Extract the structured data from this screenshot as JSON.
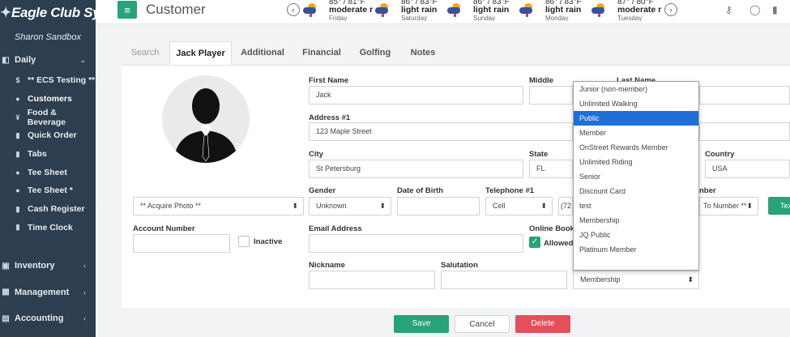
{
  "brand": {
    "name": "Eagle Club Systems",
    "subtitle": "Sharon Sandbox"
  },
  "sidebar": {
    "section_daily": "Daily",
    "items": [
      {
        "icon": "dollar-icon",
        "glyph": "$",
        "label": "** ECS Testing **"
      },
      {
        "icon": "user-icon",
        "glyph": "●",
        "label": "Customers"
      },
      {
        "icon": "cutlery-icon",
        "glyph": "¥",
        "label": "Food & Beverage"
      },
      {
        "icon": "cart-icon",
        "glyph": "▮",
        "label": "Quick Order"
      },
      {
        "icon": "cart-icon",
        "glyph": "▮",
        "label": "Tabs"
      },
      {
        "icon": "golf-icon",
        "glyph": "●",
        "label": "Tee Sheet"
      },
      {
        "icon": "golf-icon",
        "glyph": "●",
        "label": "Tee Sheet *"
      },
      {
        "icon": "register-icon",
        "glyph": "▮",
        "label": "Cash Register"
      },
      {
        "icon": "clock-icon",
        "glyph": "▮",
        "label": "Time Clock"
      }
    ],
    "section_inventory": "Inventory",
    "section_management": "Management",
    "section_accounting": "Accounting"
  },
  "header": {
    "title": "Customer"
  },
  "weather": [
    {
      "temp": "85° / 81°F",
      "cond": "moderate r...",
      "day": "Friday"
    },
    {
      "temp": "86° / 83°F",
      "cond": "light rain",
      "day": "Saturday"
    },
    {
      "temp": "86° / 83°F",
      "cond": "light rain",
      "day": "Sunday"
    },
    {
      "temp": "86° / 83°F",
      "cond": "light rain",
      "day": "Monday"
    },
    {
      "temp": "87° / 80°F",
      "cond": "moderate r...",
      "day": "Tuesday"
    }
  ],
  "tabs": [
    "Search",
    "Jack Player",
    "Additional",
    "Financial",
    "Golfing",
    "Notes"
  ],
  "form": {
    "first_name_label": "First Name",
    "first_name": "Jack",
    "middle_label": "Middle",
    "last_name_label": "Last Name",
    "address1_label": "Address #1",
    "address1": "123 Maple Street",
    "city_label": "City",
    "city": "St Petersburg",
    "state_label": "State",
    "state": "FL",
    "country_label": "Country",
    "country": "USA",
    "photo_select": "** Acquire Photo **",
    "gender_label": "Gender",
    "gender": "Unknown",
    "dob_label": "Date of Birth",
    "telephone_label": "Telephone #1",
    "phone_type": "Cell",
    "phone_number": "(72",
    "number_label_fragment": "nber",
    "number_select_fragment": "To Number **",
    "text_button": "Tex",
    "account_number_label": "Account Number",
    "inactive_label": "Inactive",
    "email_label": "Email Address",
    "online_booking_label": "Online Bookin",
    "allowed_label": "Allowed",
    "nickname_label": "Nickname",
    "salutation_label": "Salutation",
    "membership_selected": "Membership"
  },
  "dropdown": {
    "options": [
      "Junior (non-member)",
      "Unlimited Walking",
      "Public",
      "Member",
      "OnStreet Rewards Member",
      "Unlimited Riding",
      "Senior",
      "Discount Card",
      "test",
      "Membership",
      "JQ Public",
      "Platinum Member"
    ],
    "highlighted": "Public"
  },
  "buttons": {
    "save": "Save",
    "cancel": "Cancel",
    "delete": "Delete"
  },
  "colors": {
    "sidebar": "#2c3e4f",
    "accent": "#26a37a",
    "danger": "#e4505a",
    "highlight": "#1e6fd9"
  }
}
